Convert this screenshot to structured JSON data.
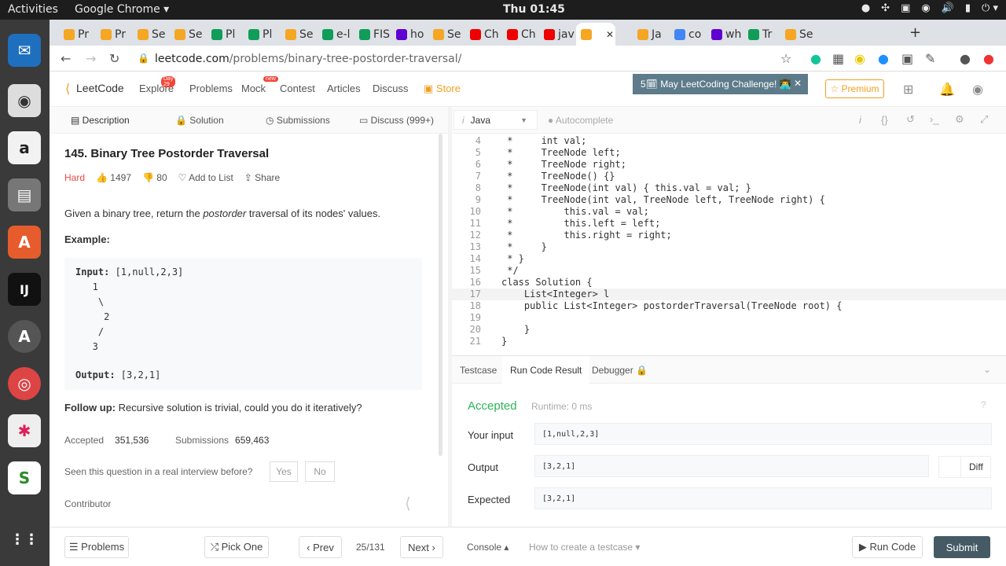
{
  "topbar": {
    "activities": "Activities",
    "app": "Google Chrome ▾",
    "clock": "Thu 01:45",
    "tray": [
      "●",
      "✣",
      "▣",
      "◉",
      "🔊",
      "▮",
      "⏻ ▾"
    ]
  },
  "dock": [
    {
      "name": "thunderbird",
      "glyph": "✉",
      "color": "#1f6fbf"
    },
    {
      "name": "rhythmbox",
      "glyph": "◉",
      "color": "#ddd"
    },
    {
      "name": "amazon",
      "glyph": "a",
      "color": "#f2f2f2"
    },
    {
      "name": "files",
      "glyph": "▤",
      "color": "#777"
    },
    {
      "name": "software",
      "glyph": "A",
      "color": "#e65c2c"
    },
    {
      "name": "intellij",
      "glyph": "IJ",
      "color": "#111"
    },
    {
      "name": "update",
      "glyph": "A",
      "color": "#555"
    },
    {
      "name": "chrome",
      "glyph": "◎",
      "color": "#d44"
    },
    {
      "name": "slack",
      "glyph": "✱",
      "color": "#eee"
    },
    {
      "name": "app",
      "glyph": "S",
      "color": "#fff"
    },
    {
      "name": "apps-grid",
      "glyph": "⋮⋮",
      "color": "#3a3a3a"
    }
  ],
  "chrome": {
    "tabs": [
      {
        "label": "Pr",
        "color": "#f5a623"
      },
      {
        "label": "Pr",
        "color": "#f5a623"
      },
      {
        "label": "Se",
        "color": "#f5a623"
      },
      {
        "label": "Se",
        "color": "#f5a623"
      },
      {
        "label": "Pl",
        "color": "#0f9d58"
      },
      {
        "label": "Pl",
        "color": "#0f9d58"
      },
      {
        "label": "Se",
        "color": "#f5a623"
      },
      {
        "label": "e-l",
        "color": "#0f9d58"
      },
      {
        "label": "FIS",
        "color": "#0f9d58"
      },
      {
        "label": "ho",
        "color": "#6001d2"
      },
      {
        "label": "Se",
        "color": "#f5a623"
      },
      {
        "label": "Ch",
        "color": "#e00"
      },
      {
        "label": "Ch",
        "color": "#e00"
      },
      {
        "label": "jav",
        "color": "#e00"
      },
      {
        "label": "",
        "color": "#f5a623",
        "active": true
      },
      {
        "label": "Ja",
        "color": "#f5a623"
      },
      {
        "label": "co",
        "color": "#4285f4"
      },
      {
        "label": "wh",
        "color": "#6001d2"
      },
      {
        "label": "Tr",
        "color": "#0f9d58"
      },
      {
        "label": "Se",
        "color": "#f5a623"
      }
    ],
    "close": "✕",
    "new_tab": "+",
    "url_host": "leetcode.com",
    "url_path": "/problems/binary-tree-postorder-traversal/"
  },
  "header": {
    "logo": "LeetCode",
    "nav": [
      "Explore",
      "Problems",
      "Mock",
      "Contest",
      "Articles",
      "Discuss",
      "Store"
    ],
    "explore_badge": "Day 29",
    "mock_badge": "new",
    "challenge": "5🗓 May LeetCoding Challenge! 👨‍💻",
    "premium": "☆ Premium"
  },
  "left_tabs": [
    "Description",
    "Solution",
    "Submissions",
    "Discuss (999+)"
  ],
  "problem": {
    "title": "145. Binary Tree Postorder Traversal",
    "difficulty": "Hard",
    "likes": "1497",
    "dislikes": "80",
    "add_to_list": "Add to List",
    "share": "Share",
    "desc_prefix": "Given a binary tree, return the ",
    "desc_em": "postorder",
    "desc_suffix": " traversal of its nodes' values.",
    "example_label": "Example:",
    "input_label": "Input:",
    "input_val": " [1,null,2,3]",
    "tree": [
      "   1",
      "    \\",
      "     2",
      "    /",
      "   3"
    ],
    "output_label": "Output:",
    "output_val": " [3,2,1]",
    "followup_label": "Follow up:",
    "followup_text": " Recursive solution is trivial, could you do it iteratively?",
    "accepted_label": "Accepted",
    "accepted_val": "351,536",
    "submissions_label": "Submissions",
    "submissions_val": "659,463",
    "seen_q": "Seen this question in a real interview before?",
    "yes": "Yes",
    "no": "No",
    "contributor": "Contributor"
  },
  "editor": {
    "language": "Java",
    "autocomplete": "Autocomplete",
    "lines": [
      {
        "n": "4",
        "t": " *     int val;",
        "c": "cm"
      },
      {
        "n": "5",
        "t": " *     TreeNode left;",
        "c": "cm"
      },
      {
        "n": "6",
        "t": " *     TreeNode right;",
        "c": "cm"
      },
      {
        "n": "7",
        "t": " *     TreeNode() {}",
        "c": "cm"
      },
      {
        "n": "8",
        "t": " *     TreeNode(int val) { this.val = val; }",
        "c": "cm"
      },
      {
        "n": "9",
        "t": " *     TreeNode(int val, TreeNode left, TreeNode right) {",
        "c": "cm"
      },
      {
        "n": "10",
        "t": " *         this.val = val;",
        "c": "cm"
      },
      {
        "n": "11",
        "t": " *         this.left = left;",
        "c": "cm"
      },
      {
        "n": "12",
        "t": " *         this.right = right;",
        "c": "cm"
      },
      {
        "n": "13",
        "t": " *     }",
        "c": "cm"
      },
      {
        "n": "14",
        "t": " * }",
        "c": "cm"
      },
      {
        "n": "15",
        "t": " */",
        "c": "cm"
      },
      {
        "n": "16",
        "t": "class Solution {",
        "c": "code"
      },
      {
        "n": "17",
        "t": "    List<Integer> l",
        "c": "code"
      },
      {
        "n": "18",
        "t": "    public List<Integer> postorderTraversal(TreeNode root) {",
        "c": "code"
      },
      {
        "n": "19",
        "t": "",
        "c": "code"
      },
      {
        "n": "20",
        "t": "    }",
        "c": "code"
      },
      {
        "n": "21",
        "t": "}",
        "c": "code"
      }
    ]
  },
  "console_tabs": [
    "Testcase",
    "Run Code Result",
    "Debugger"
  ],
  "result": {
    "status": "Accepted",
    "runtime": "Runtime: 0 ms",
    "input_label": "Your input",
    "input_val": "[1,null,2,3]",
    "output_label": "Output",
    "output_val": "[3,2,1]",
    "diff": "Diff",
    "expected_label": "Expected",
    "expected_val": "[3,2,1]"
  },
  "bottom": {
    "problems": "☰ Problems",
    "pick_one": "⤮ Pick One",
    "prev": "‹  Prev",
    "page": "25/131",
    "next": "Next  ›",
    "console": "Console ▴",
    "howto": "How to create a testcase ▾",
    "run": "▶ Run Code",
    "submit": "Submit"
  }
}
